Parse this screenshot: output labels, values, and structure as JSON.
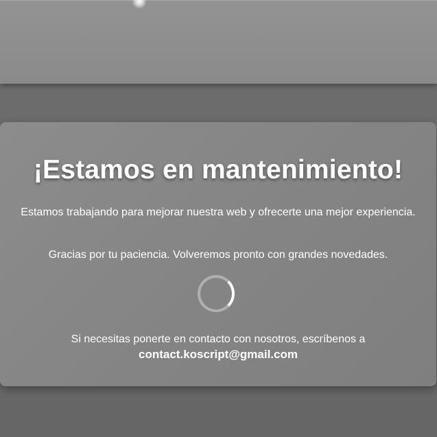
{
  "maintenance": {
    "title": "¡Estamos en mantenimiento!",
    "description": "Estamos trabajando para mejorar nuestra web y ofrecerte una mejor experiencia.",
    "thanks": "Gracias por tu paciencia. Volveremos pronto con grandes novedades.",
    "contact_text": "Si necesitas ponerte en contacto con nosotros, escríbenos a",
    "contact_email": "contact.koscript@gmail.com"
  },
  "icons": {
    "loader": "loading-spinner-icon"
  },
  "colors": {
    "text": "#ffffff",
    "card": "#888888",
    "banner": "#8f8f8f",
    "background": "#6b6b6b"
  }
}
